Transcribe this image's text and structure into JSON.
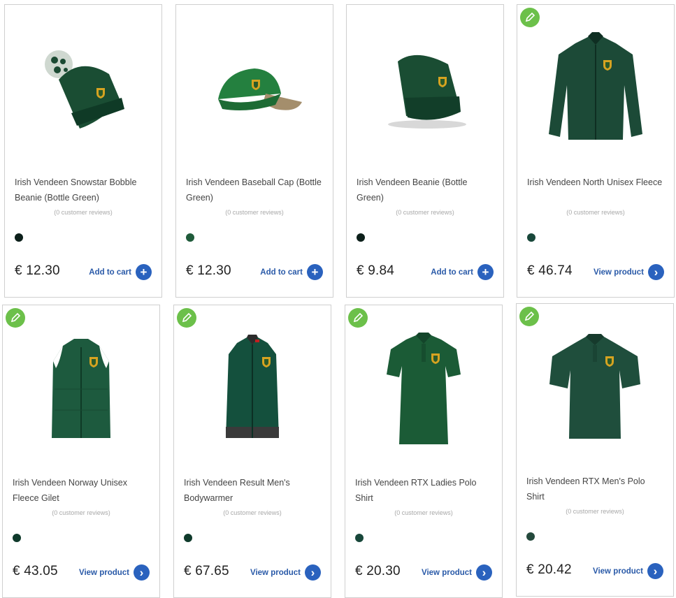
{
  "accent_color": "#2a62be",
  "badge_color": "#6cc04a",
  "products": [
    {
      "title": "Irish Vendeen Snowstar Bobble Beanie (Bottle Green)",
      "reviews": "(0 customer reviews)",
      "swatch_color": "#0c1f1a",
      "price": "€ 12.30",
      "action_label": "Add to cart",
      "action_icon": "plus-icon",
      "has_badge": false,
      "image": "bobble-beanie-image"
    },
    {
      "title": "Irish Vendeen Baseball Cap (Bottle Green)",
      "reviews": "(0 customer reviews)",
      "swatch_color": "#1f5b3a",
      "price": "€ 12.30",
      "action_label": "Add to cart",
      "action_icon": "plus-icon",
      "has_badge": false,
      "image": "baseball-cap-image"
    },
    {
      "title": "Irish Vendeen Beanie (Bottle Green)",
      "reviews": "(0 customer reviews)",
      "swatch_color": "#0c1f1a",
      "price": "€ 9.84",
      "action_label": "Add to cart",
      "action_icon": "plus-icon",
      "has_badge": false,
      "image": "beanie-image"
    },
    {
      "title": "Irish Vendeen North Unisex Fleece",
      "reviews": "(0 customer reviews)",
      "swatch_color": "#18473a",
      "price": "€ 46.74",
      "action_label": "View product",
      "action_icon": "chevron-right-icon",
      "has_badge": true,
      "image": "fleece-jacket-image"
    },
    {
      "title": "Irish Vendeen Norway Unisex Fleece Gilet",
      "reviews": "(0 customer reviews)",
      "swatch_color": "#0f3a2b",
      "price": "€ 43.05",
      "action_label": "View product",
      "action_icon": "chevron-right-icon",
      "has_badge": true,
      "image": "fleece-gilet-image"
    },
    {
      "title": "Irish Vendeen Result Men's Bodywarmer",
      "reviews": "(0 customer reviews)",
      "swatch_color": "#0f3a2b",
      "price": "€ 67.65",
      "action_label": "View product",
      "action_icon": "chevron-right-icon",
      "has_badge": true,
      "image": "bodywarmer-image"
    },
    {
      "title": "Irish Vendeen RTX Ladies Polo Shirt",
      "reviews": "(0 customer reviews)",
      "swatch_color": "#18473a",
      "price": "€ 20.30",
      "action_label": "View product",
      "action_icon": "chevron-right-icon",
      "has_badge": true,
      "image": "ladies-polo-image"
    },
    {
      "title": "Irish Vendeen RTX Men's Polo Shirt",
      "reviews": "(0 customer reviews)",
      "swatch_color": "#24493c",
      "price": "€ 20.42",
      "action_label": "View product",
      "action_icon": "chevron-right-icon",
      "has_badge": true,
      "image": "mens-polo-image"
    }
  ]
}
